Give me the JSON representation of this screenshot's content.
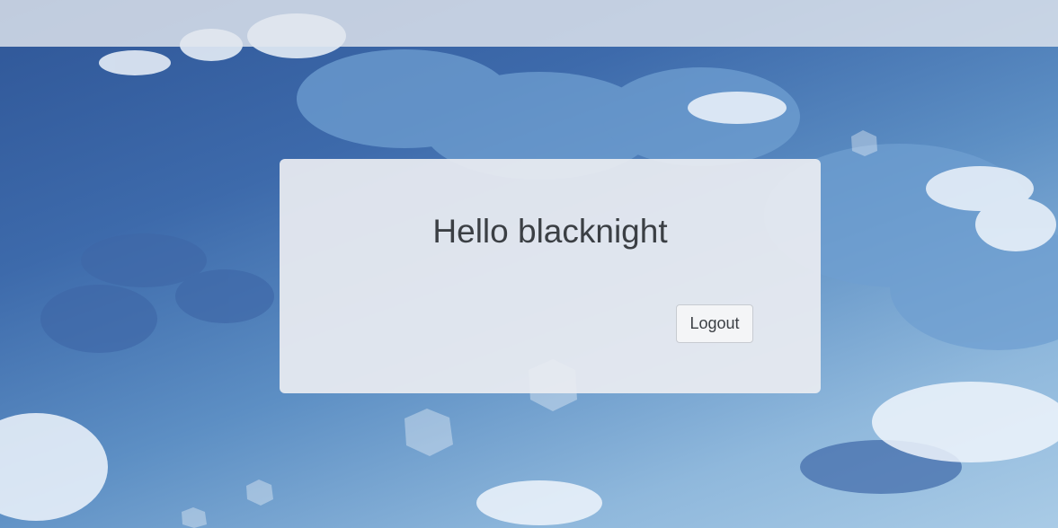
{
  "main": {
    "greeting": "Hello blacknight",
    "logout_label": "Logout"
  }
}
